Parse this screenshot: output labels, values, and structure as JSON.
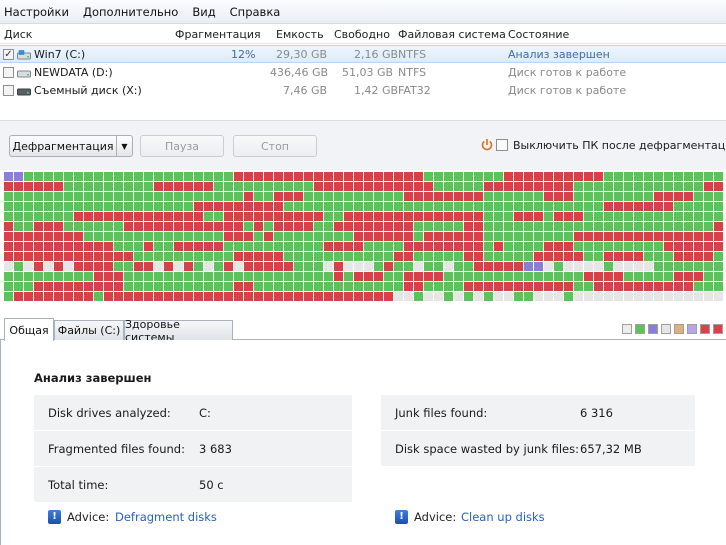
{
  "menu": [
    "Настройки",
    "Дополнительно",
    "Вид",
    "Справка"
  ],
  "drive_list": {
    "headers": {
      "disk": "Диск",
      "fragmentation": "Фрагментация",
      "capacity": "Емкость",
      "free": "Свободно",
      "filesystem": "Файловая система",
      "status": "Состояние"
    },
    "rows": [
      {
        "checked": true,
        "name": "Win7 (C:)",
        "fragmentation": "12%",
        "capacity": "29,30 GB",
        "free": "2,16 GB",
        "filesystem": "NTFS",
        "status": "Анализ завершен"
      },
      {
        "checked": false,
        "name": "NEWDATA (D:)",
        "fragmentation": "",
        "capacity": "436,46 GB",
        "free": "51,03 GB",
        "filesystem": "NTFS",
        "status": "Диск готов к работе"
      },
      {
        "checked": false,
        "name": "Съемный диск (X:)",
        "fragmentation": "",
        "capacity": "7,46 GB",
        "free": "1,42 GB",
        "filesystem": "FAT32",
        "status": "Диск готов к работе"
      }
    ]
  },
  "toolbar": {
    "defrag_label": "Дефрагментация",
    "pause_label": "Пауза",
    "stop_label": "Стоп",
    "shutdown_label": "Выключить ПК после дефрагментации"
  },
  "cluster_colors": {
    "fragmented": "#d9404a",
    "normal": "#5cc35c",
    "free": "#e6e6e6",
    "system": "#8a7fd6"
  },
  "tabs": [
    "Общая",
    "Файлы (C:)",
    "Здоровье системы"
  ],
  "legend_colors": [
    "#ececec",
    "#5cc35c",
    "#8a7fd6",
    "#e5e5e5",
    "#e0b07a",
    "#b9a4e6",
    "#d9404a",
    "#d9404a"
  ],
  "panel": {
    "title": "Анализ завершен",
    "left": [
      {
        "label": "Disk drives analyzed:",
        "value": "C:"
      },
      {
        "label": "Fragmented files found:",
        "value": "3 683"
      },
      {
        "label": "Total time:",
        "value": "50 c"
      }
    ],
    "right": [
      {
        "label": "Junk files found:",
        "value": "6 316"
      },
      {
        "label": "Disk space wasted by junk files:",
        "value": "657,32 MB"
      }
    ],
    "advice_label": "Advice:",
    "advice_left_link": "Defragment disks",
    "advice_right_link": "Clean up disks"
  }
}
